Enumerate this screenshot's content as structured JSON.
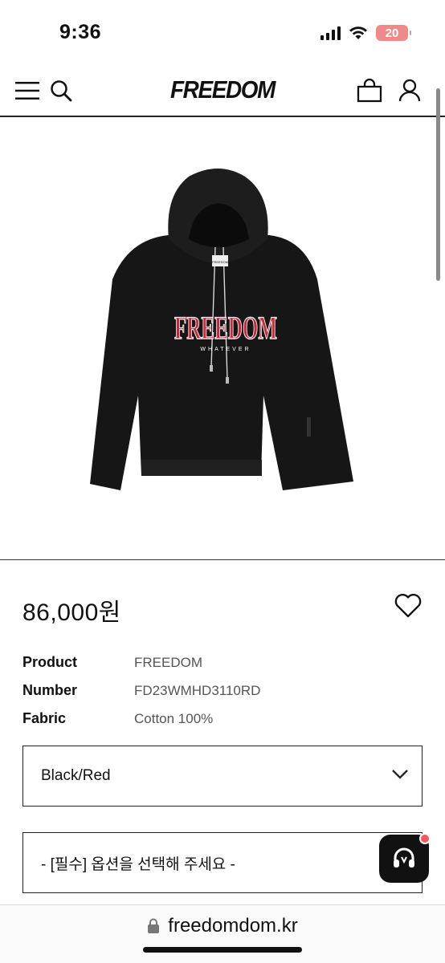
{
  "status_bar": {
    "time": "9:36",
    "battery_level": "20",
    "icons": [
      "signal-icon",
      "wifi-icon",
      "battery-icon"
    ]
  },
  "header": {
    "logo": "FREEDOM",
    "icons": [
      "menu-icon",
      "search-icon",
      "shopping-bag-icon",
      "user-icon"
    ]
  },
  "product": {
    "image_graphic": {
      "chest_print": "FREEDOM",
      "chest_subprint": "WHATEVER",
      "label": "FREEDOM"
    },
    "price": "86,000원",
    "info": [
      {
        "label": "Product",
        "value": "FREEDOM"
      },
      {
        "label": "Number",
        "value": "FD23WMHD3110RD"
      },
      {
        "label": "Fabric",
        "value": "Cotton 100%"
      }
    ],
    "color_select": {
      "selected": "Black/Red"
    },
    "option_select": {
      "placeholder": "- [필수] 옵션을 선택해 주세요 -"
    }
  },
  "browser": {
    "url": "freedomdom.kr"
  },
  "colors": {
    "accent_red": "#c8283a",
    "garment": "#161616",
    "notification_dot": "#ef5a5a",
    "battery": "#ef8a88"
  }
}
